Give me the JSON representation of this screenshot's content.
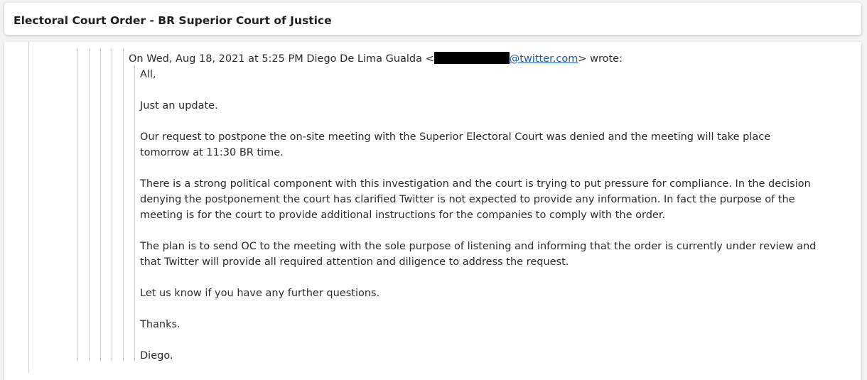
{
  "email": {
    "subject": "Electoral Court Order - BR Superior Court of Justice",
    "quote_header": {
      "prefix": "On Wed, Aug 18, 2021 at 5:25 PM Diego De Lima Gualda <",
      "email_domain": "@twitter.com",
      "suffix": "> wrote:"
    },
    "paragraphs": [
      "All,",
      "Just an update.",
      "Our  request to postpone the on-site meeting with the Superior Electoral Court was denied and the meeting will take place tomorrow at 11:30 BR time.",
      "There is a strong political component with this investigation and the court is trying to put pressure for compliance. In the decision denying the postponement the court has clarified Twitter is not expected to provide any information. In fact the purpose of the meeting is for the court to provide additional instructions for the companies to comply with the order.",
      "The plan is to send OC to the meeting with the sole purpose of listening and informing that the order is currently under review and that Twitter will provide all required attention and diligence to address the request.",
      "Let us know if you have any further questions.",
      "Thanks.",
      "Diego."
    ]
  }
}
